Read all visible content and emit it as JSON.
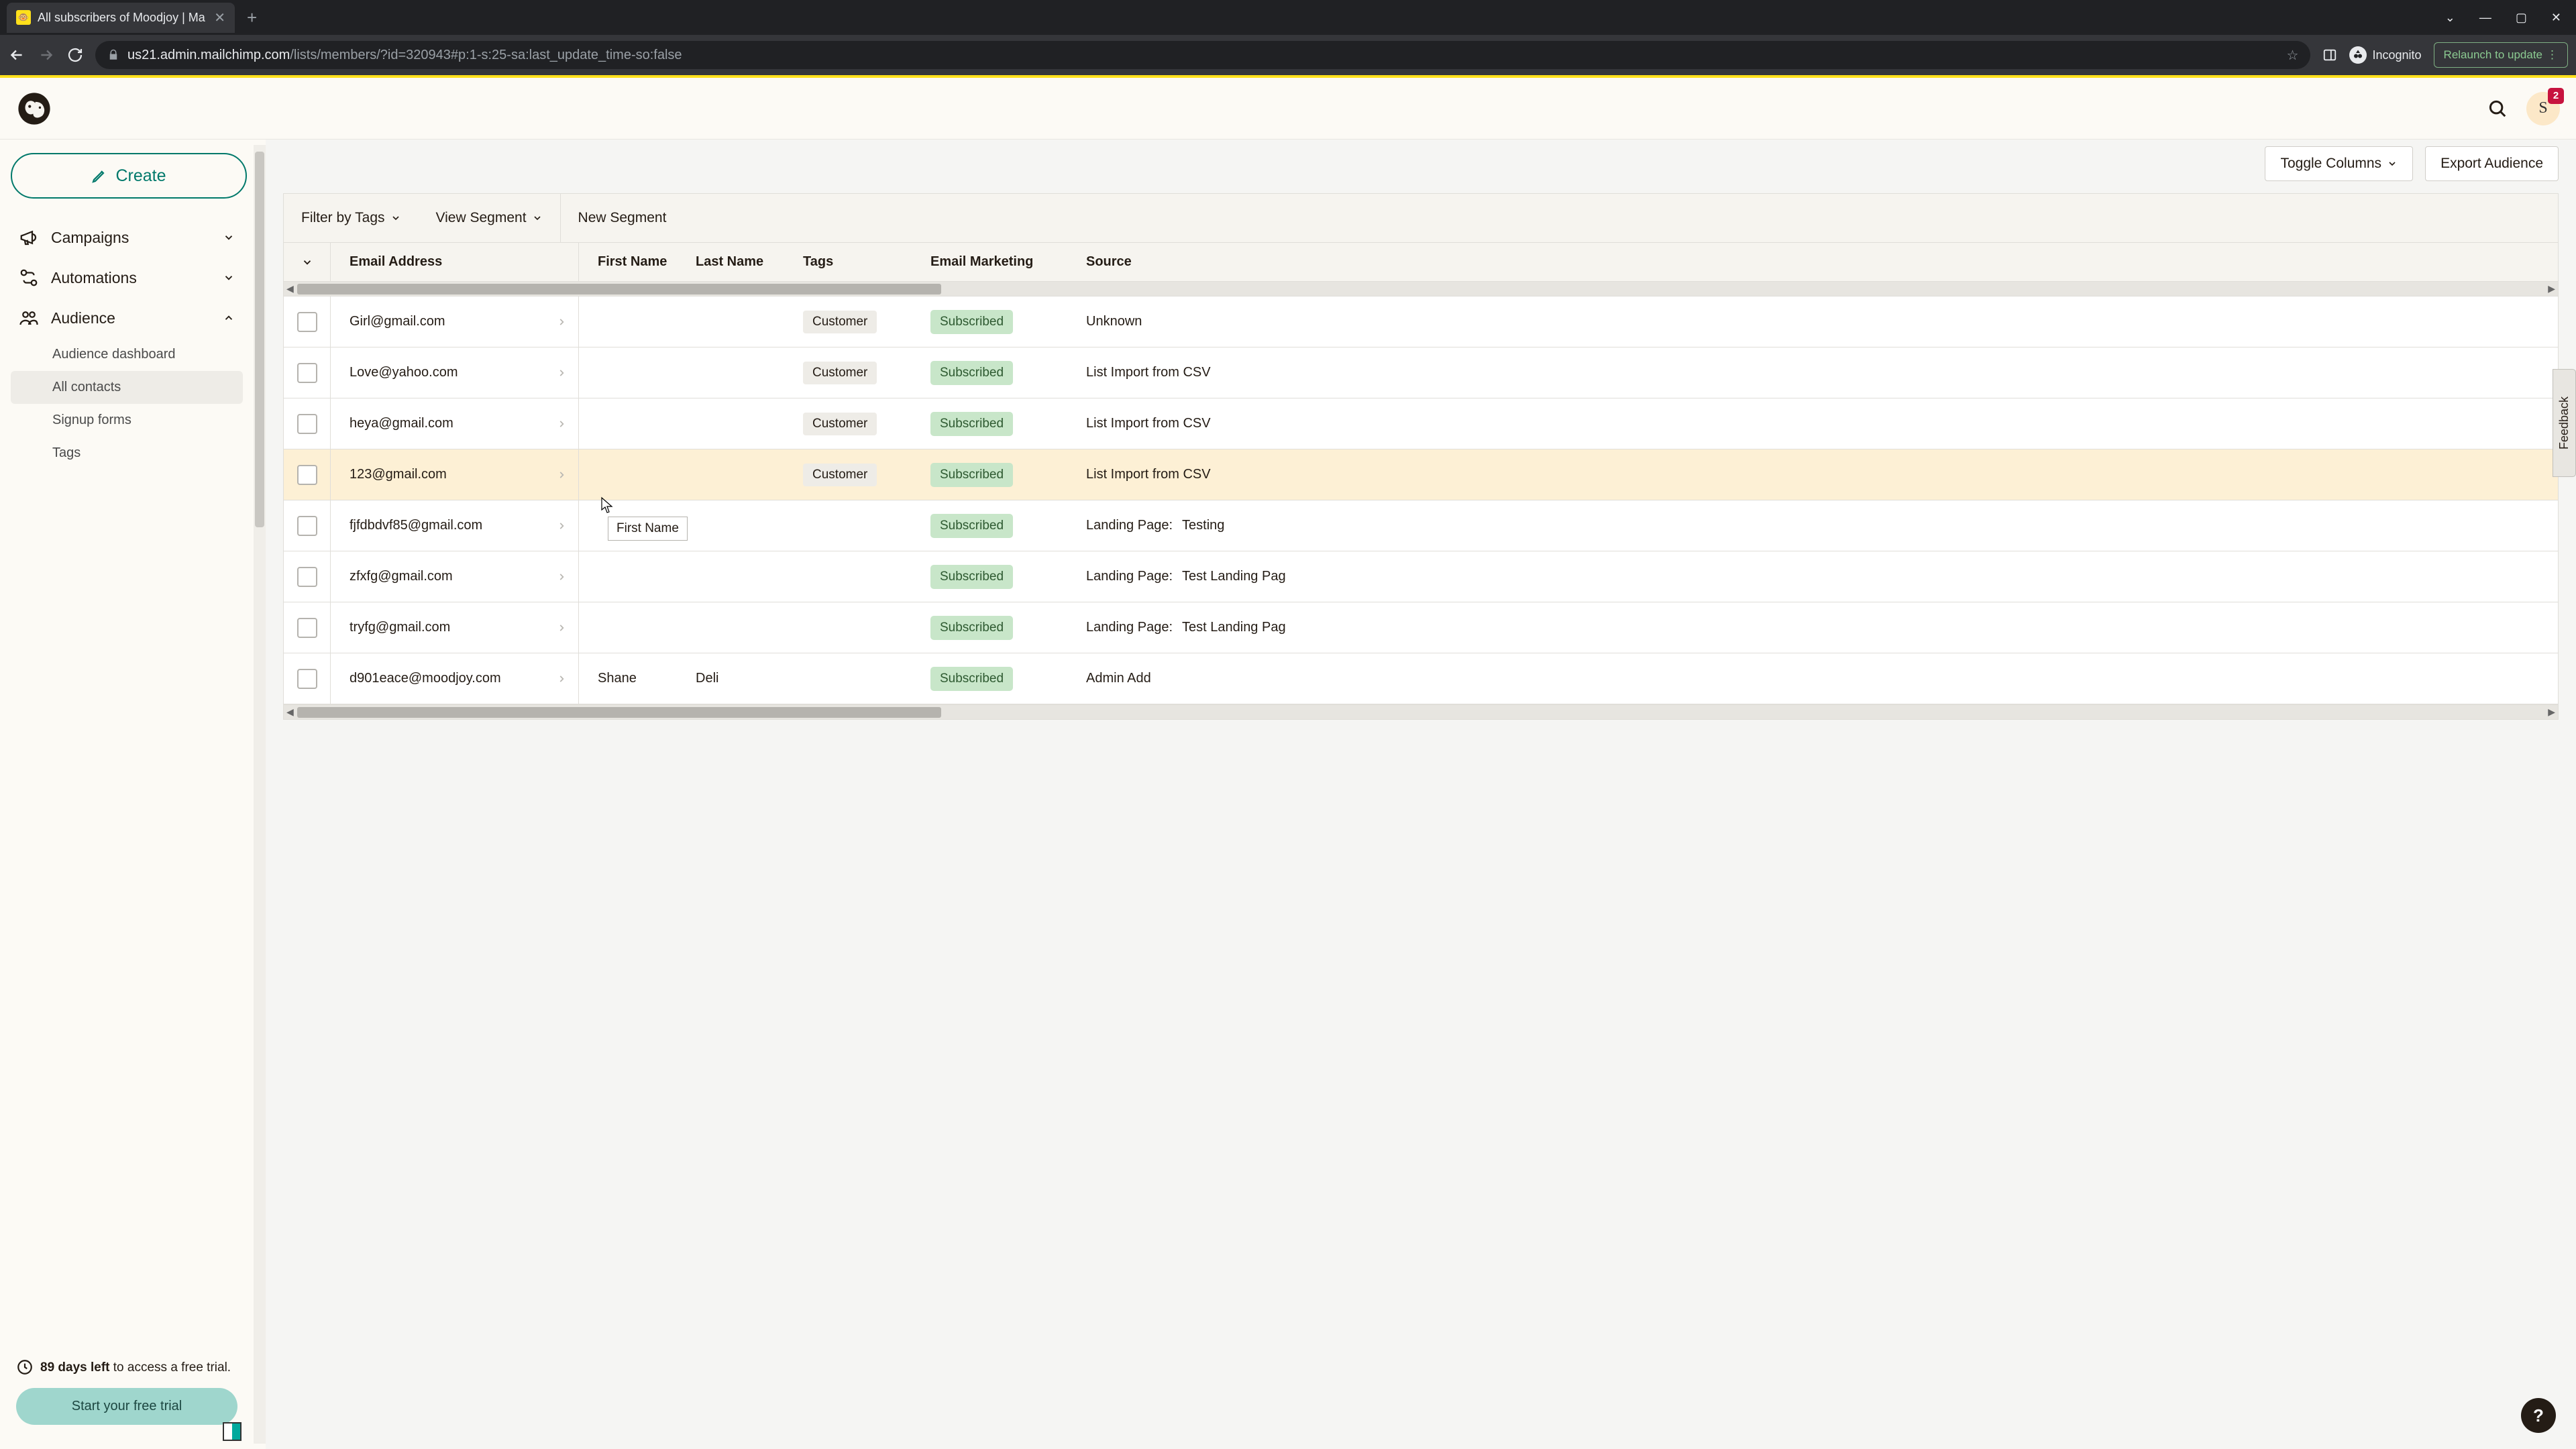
{
  "browser": {
    "tab_title": "All subscribers of Moodjoy | Ma",
    "url_domain": "us21.admin.mailchimp.com",
    "url_path": "/lists/members/?id=320943#p:1-s:25-sa:last_update_time-so:false",
    "incognito_label": "Incognito",
    "relaunch_label": "Relaunch to update"
  },
  "header": {
    "avatar_initial": "S",
    "badge_count": "2"
  },
  "sidebar": {
    "create_label": "Create",
    "items": [
      {
        "label": "Campaigns"
      },
      {
        "label": "Automations"
      },
      {
        "label": "Audience"
      }
    ],
    "sub_items": [
      {
        "label": "Audience dashboard"
      },
      {
        "label": "All contacts"
      },
      {
        "label": "Signup forms"
      },
      {
        "label": "Tags"
      }
    ],
    "trial": {
      "days_bold": "89 days left",
      "days_rest": " to access a free trial.",
      "cta": "Start your free trial"
    }
  },
  "actions": {
    "toggle_columns": "Toggle Columns",
    "export_audience": "Export Audience"
  },
  "toolbar": {
    "filter_tags": "Filter by Tags",
    "view_segment": "View Segment",
    "new_segment": "New Segment"
  },
  "columns": {
    "email": "Email Address",
    "first_name": "First Name",
    "last_name": "Last Name",
    "tags": "Tags",
    "email_marketing": "Email Marketing",
    "source": "Source"
  },
  "tooltip": "First Name",
  "rows": [
    {
      "email": "Girl@gmail.com",
      "first_name": "",
      "last_name": "",
      "tag": "Customer",
      "status": "Subscribed",
      "source_prefix": "",
      "source": "Unknown"
    },
    {
      "email": "Love@yahoo.com",
      "first_name": "",
      "last_name": "",
      "tag": "Customer",
      "status": "Subscribed",
      "source_prefix": "",
      "source": "List Import from CSV"
    },
    {
      "email": "heya@gmail.com",
      "first_name": "",
      "last_name": "",
      "tag": "Customer",
      "status": "Subscribed",
      "source_prefix": "",
      "source": "List Import from CSV"
    },
    {
      "email": "123@gmail.com",
      "first_name": "",
      "last_name": "",
      "tag": "Customer",
      "status": "Subscribed",
      "source_prefix": "",
      "source": "List Import from CSV"
    },
    {
      "email": "fjfdbdvf85@gmail.com",
      "first_name": "",
      "last_name": "",
      "tag": "",
      "status": "Subscribed",
      "source_prefix": "Landing Page:",
      "source": "Testing"
    },
    {
      "email": "zfxfg@gmail.com",
      "first_name": "",
      "last_name": "",
      "tag": "",
      "status": "Subscribed",
      "source_prefix": "Landing Page:",
      "source": "Test Landing Pag"
    },
    {
      "email": "tryfg@gmail.com",
      "first_name": "",
      "last_name": "",
      "tag": "",
      "status": "Subscribed",
      "source_prefix": "Landing Page:",
      "source": "Test Landing Pag"
    },
    {
      "email": "d901eace@moodjoy.com",
      "first_name": "Shane",
      "last_name": "Deli",
      "tag": "",
      "status": "Subscribed",
      "source_prefix": "",
      "source": "Admin Add"
    }
  ],
  "feedback_label": "Feedback",
  "help_label": "?"
}
